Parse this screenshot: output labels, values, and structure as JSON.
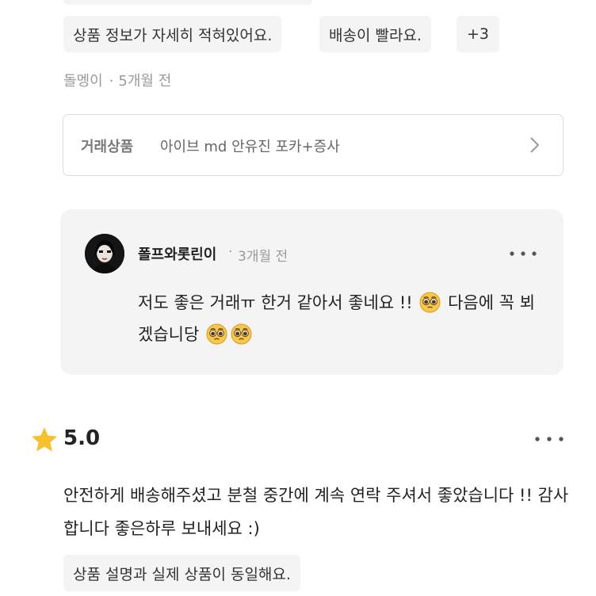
{
  "prev_review": {
    "tags": [
      "상품 정보가 자세히 적혀있어요.",
      "배송이 빨라요.",
      "+3"
    ],
    "author": "돌멩이",
    "time": "5개월 전"
  },
  "product_card": {
    "label": "거래상품",
    "name": "아이브 md 안유진 포카+증사"
  },
  "reply": {
    "author": "폴프와롯린이",
    "time": "3개월 전",
    "text_part1": "저도 좋은 거래ㅠ 한거 같아서 좋네요 !!",
    "text_part2": "다음에 꼭 뵈겠습니당",
    "emoji": "pleading-face"
  },
  "review": {
    "rating": "5.0",
    "star_color": "#f6c12b",
    "text": "안전하게 배송해주셨고 분철 중간에 계속 연락 주셔서 좋았습니다 !! 감사합니다 좋은하루 보내세요 :)",
    "tags": [
      "상품 설명과 실제 상품이 동일해요."
    ]
  }
}
